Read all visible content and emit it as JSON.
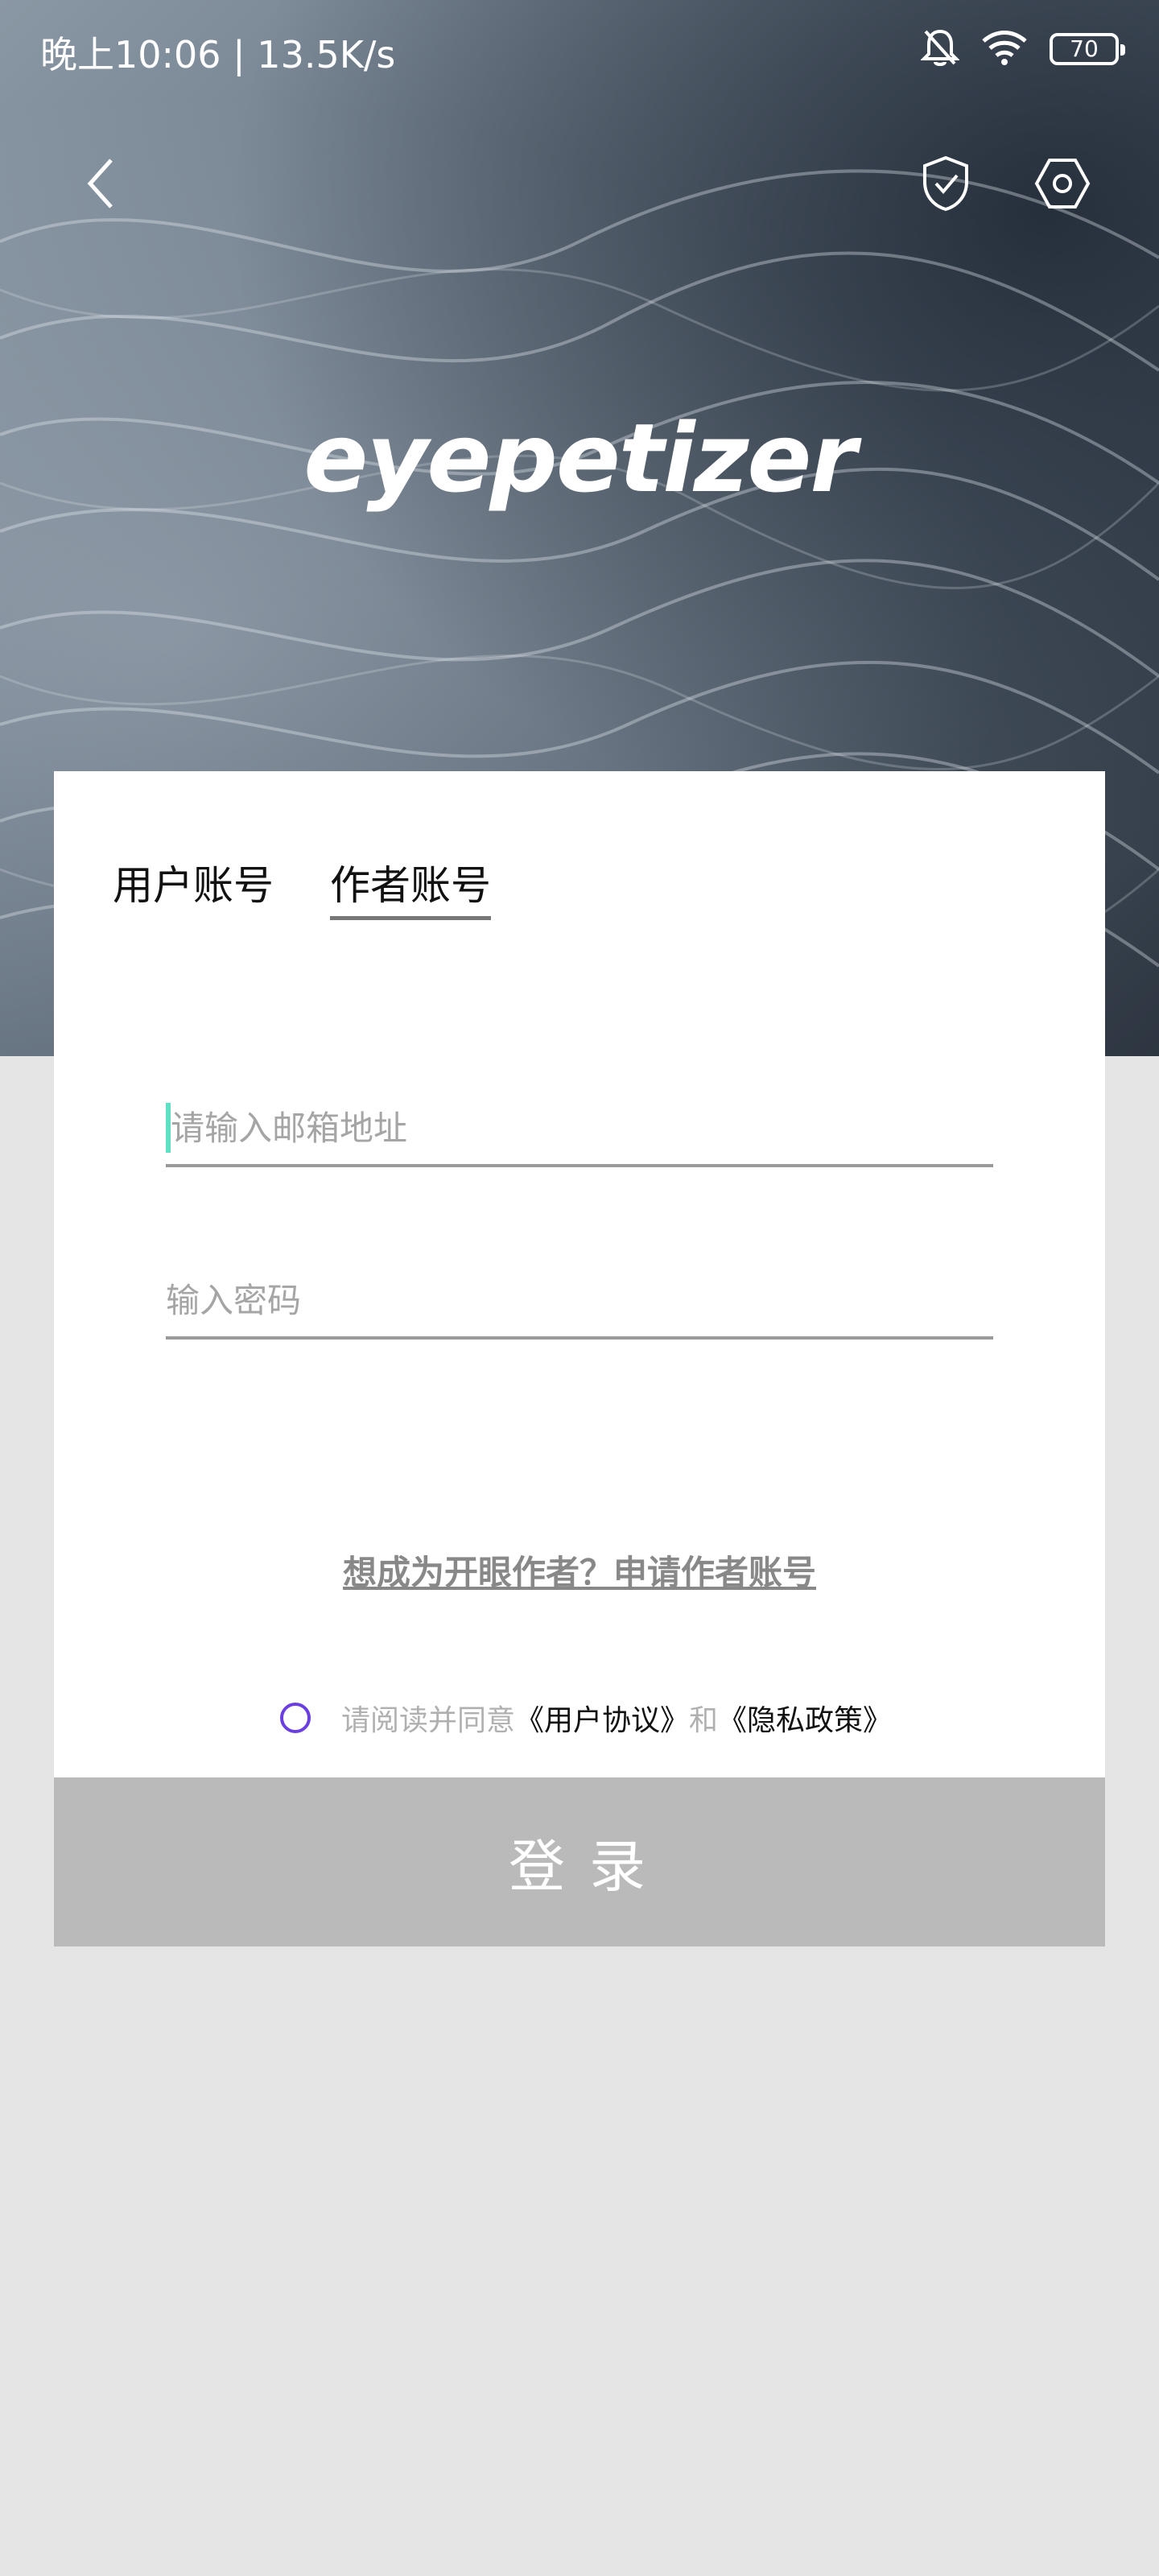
{
  "status_bar": {
    "time": "晚上10:06 | 13.5K/s",
    "battery": "70",
    "icons": [
      "bell-off-icon",
      "wifi-icon",
      "battery-icon"
    ]
  },
  "header": {
    "back_icon": "chevron-left-icon",
    "shield_icon": "shield-check-icon",
    "settings_icon": "hexagon-settings-icon"
  },
  "logo": "eyepetizer",
  "tabs": [
    {
      "label": "用户账号",
      "active": false
    },
    {
      "label": "作者账号",
      "active": true
    }
  ],
  "form": {
    "email_placeholder": "请输入邮箱地址",
    "password_placeholder": "输入密码"
  },
  "apply_link": "想成为开眼作者？申请作者账号",
  "agreement": {
    "prefix": "请阅读并同意",
    "user_agreement": "《用户协议》",
    "and": "和",
    "privacy_policy": "《隐私政策》"
  },
  "login_button": "登录",
  "colors": {
    "cursor": "#5fe0c5",
    "radio": "#6a3ee0",
    "button_bg": "#bababa",
    "page_bg": "#e5e5e5"
  }
}
